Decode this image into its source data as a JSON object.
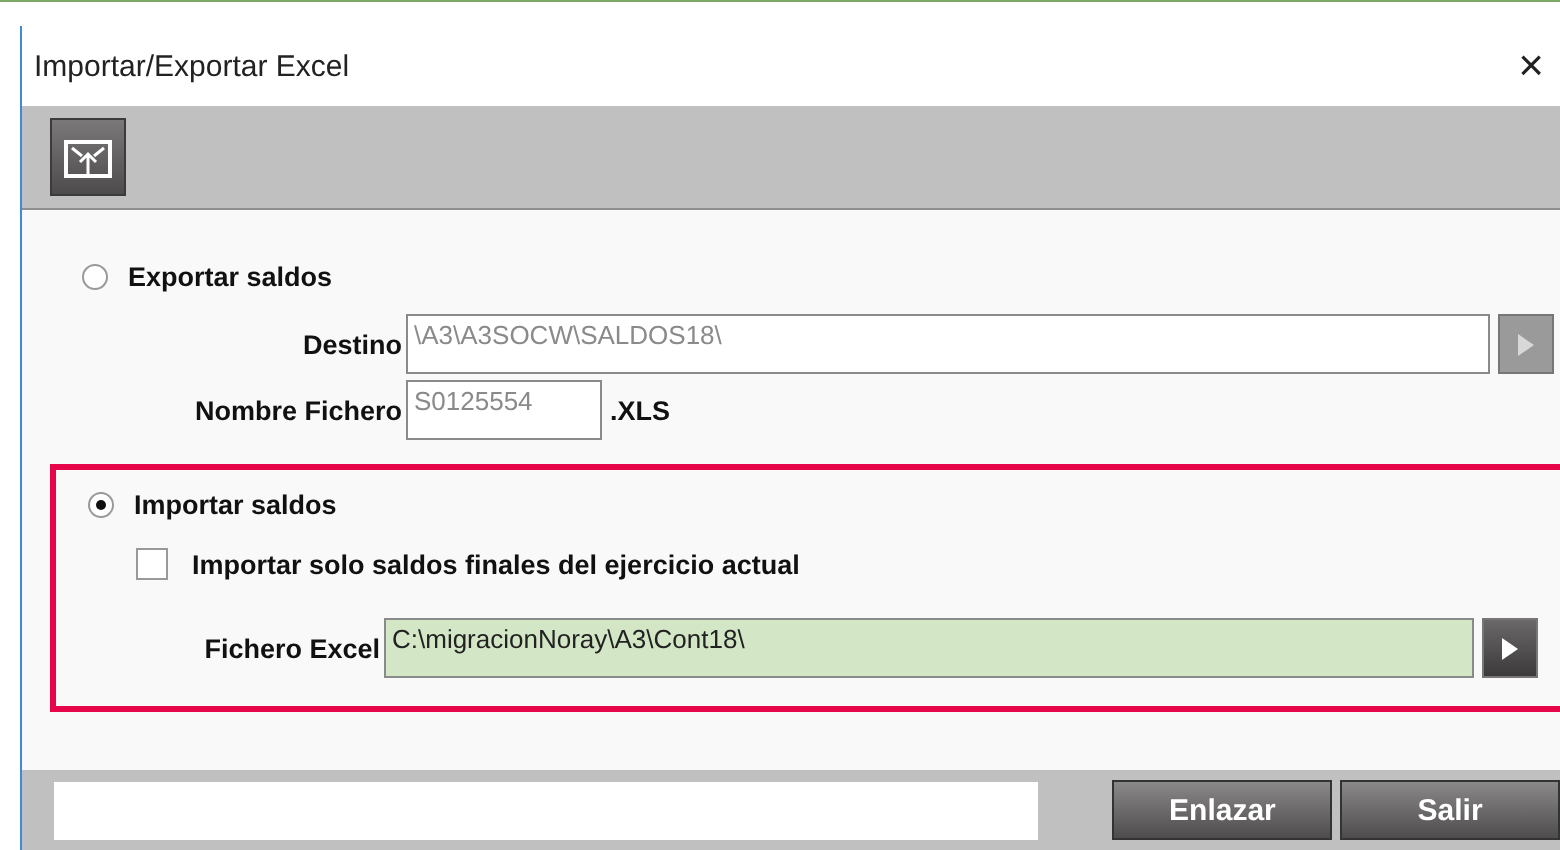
{
  "window": {
    "title": "Importar/Exportar Excel",
    "close": "×"
  },
  "options": [
    {
      "label": "Exportar saldos",
      "selected": false
    },
    {
      "label": "Importar saldos",
      "selected": true
    }
  ],
  "export": {
    "destino_label": "Destino",
    "destino_value": "\\A3\\A3SOCW\\SALDOS18\\",
    "nombre_label": "Nombre Fichero",
    "nombre_value": "S0125554",
    "extension": ".XLS"
  },
  "import": {
    "checkbox_label": "Importar solo saldos finales del ejercicio actual",
    "checked": false,
    "fichero_label": "Fichero Excel",
    "fichero_value": "C:\\migracionNoray\\A3\\Cont18\\"
  },
  "buttons": [
    "Enlazar",
    "Salir"
  ]
}
